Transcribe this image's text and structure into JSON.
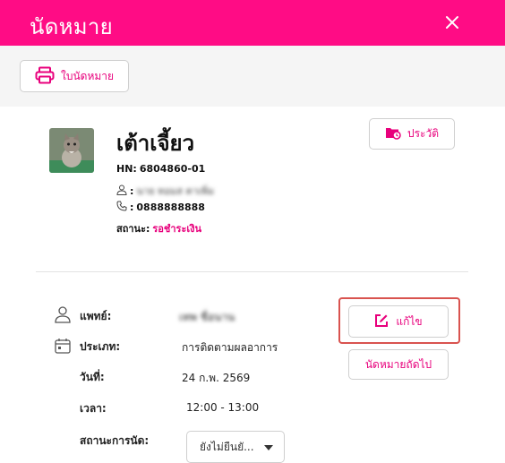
{
  "header": {
    "title": "นัดหมาย"
  },
  "toolbar": {
    "print_label": "ใบนัดหมาย"
  },
  "patient": {
    "name": "เต้าเจี้ยว",
    "hn_label": "HN:",
    "hn_value": "6804860-01",
    "owner_name": "นาย ทอมส คาเพิ่ม",
    "phone": "0888888888",
    "status_label": "สถานะ:",
    "status_value": "รอชำระเงิน"
  },
  "history_button": {
    "label": "ประวัติ"
  },
  "appointment": {
    "doctor_label": "แพทย์:",
    "doctor_value": "เทพ ชื่อนาน",
    "type_label": "ประเภท:",
    "type_value": "การติดตามผลอาการ",
    "date_label": "วันที่:",
    "date_value": "24 ก.พ. 2569",
    "time_label": "เวลา:",
    "time_value": "12:00 - 13:00",
    "status_label": "สถานะการนัด:",
    "status_selected": "ยังไม่ยืนยั..."
  },
  "actions": {
    "edit_label": "แก้ไข",
    "next_label": "นัดหมายถัดไป"
  },
  "colors": {
    "brand": "#ff0c85",
    "accent_text": "#e8007c",
    "highlight_border": "#d9534f"
  },
  "icons": [
    "close-icon",
    "printer-icon",
    "history-icon",
    "user-icon",
    "phone-icon",
    "calendar-icon",
    "edit-icon",
    "chevron-down-icon"
  ]
}
